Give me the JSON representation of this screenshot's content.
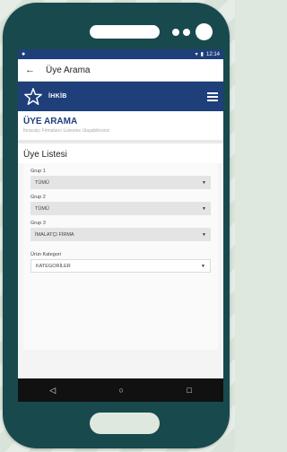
{
  "status": {
    "left_icon": "notification-dot",
    "time": "12:14"
  },
  "appbar": {
    "back_icon": "arrow-left-icon",
    "title": "Üye Arama"
  },
  "brand": {
    "logo_icon": "star-logo-icon",
    "name": "İHKİB",
    "menu_icon": "hamburger-menu-icon"
  },
  "page": {
    "title": "ÜYE ARAMA",
    "subtitle": "İhracatçı Firmaların Listesine Ulaşabilirsiniz"
  },
  "list": {
    "title": "Üye Listesi"
  },
  "filters": [
    {
      "label": "Grup 1",
      "value": "TÜMÜ"
    },
    {
      "label": "Grup 2",
      "value": "TÜMÜ"
    },
    {
      "label": "Grup 3",
      "value": "İMALATÇI FİRMA"
    }
  ],
  "category": {
    "label": "Ürün Kategori",
    "value": "KATEGORİLER"
  },
  "navbar": {
    "back": "◁",
    "home": "○",
    "recent": "□"
  },
  "colors": {
    "brand_blue": "#1f3f7a",
    "phone_body": "#18494d",
    "background": "#dfe8df"
  }
}
